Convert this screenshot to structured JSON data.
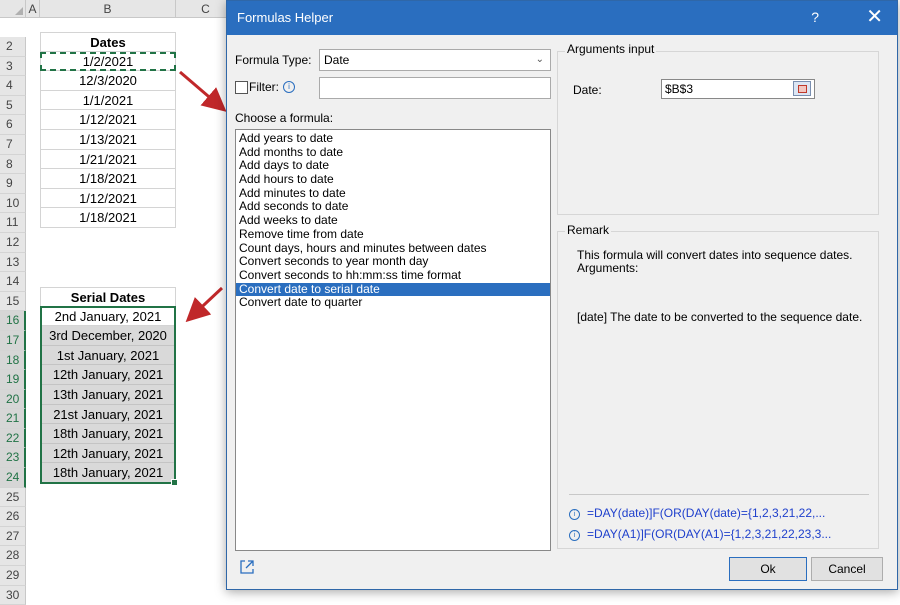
{
  "sheet": {
    "columns": [
      "A",
      "B",
      "C"
    ],
    "rows": [
      "2",
      "3",
      "4",
      "5",
      "6",
      "7",
      "8",
      "9",
      "10",
      "11",
      "12",
      "13",
      "14",
      "15",
      "16",
      "17",
      "18",
      "19",
      "20",
      "21",
      "22",
      "23",
      "24",
      "25",
      "26",
      "27",
      "28",
      "29",
      "30"
    ],
    "dates_header": "Dates",
    "dates": [
      "1/2/2021",
      "12/3/2020",
      "1/1/2021",
      "1/12/2021",
      "1/13/2021",
      "1/21/2021",
      "1/18/2021",
      "1/12/2021",
      "1/18/2021"
    ],
    "serial_header": "Serial Dates",
    "serials": [
      "2nd January, 2021",
      "3rd December, 2020",
      "1st January, 2021",
      "12th January, 2021",
      "13th January, 2021",
      "21st January, 2021",
      "18th January, 2021",
      "12th January, 2021",
      "18th January, 2021"
    ]
  },
  "dialog": {
    "title": "Formulas Helper",
    "help": "?",
    "close": "✕",
    "formula_type_label": "Formula Type:",
    "formula_type_value": "Date",
    "filter_label": "Filter:",
    "choose_label": "Choose a formula:",
    "formulas": [
      "Add years to date",
      "Add months to date",
      "Add days to date",
      "Add hours to date",
      "Add minutes to date",
      "Add seconds to date",
      "Add weeks to date",
      "Remove time from date",
      "Count days, hours and minutes between dates",
      "Convert seconds to year month day",
      "Convert seconds to hh:mm:ss time format",
      "Convert date to serial date",
      "Convert date to quarter"
    ],
    "selected_formula": "Convert date to serial date",
    "arguments_legend": "Arguments input",
    "date_label": "Date:",
    "date_value": "$B$3",
    "remark_legend": "Remark",
    "remark_text": "This formula will convert dates into sequence dates. Arguments:",
    "remark_args": "[date] The date to be converted to the sequence date.",
    "example_1": "=DAY(date)]F(OR(DAY(date)={1,2,3,21,22,...",
    "example_2": "=DAY(A1)]F(OR(DAY(A1)={1,2,3,21,22,23,3...",
    "ok_label": "Ok",
    "cancel_label": "Cancel"
  },
  "colors": {
    "accent": "#2a6ebf",
    "excel_green": "#217346",
    "arrow": "#c0282a"
  }
}
